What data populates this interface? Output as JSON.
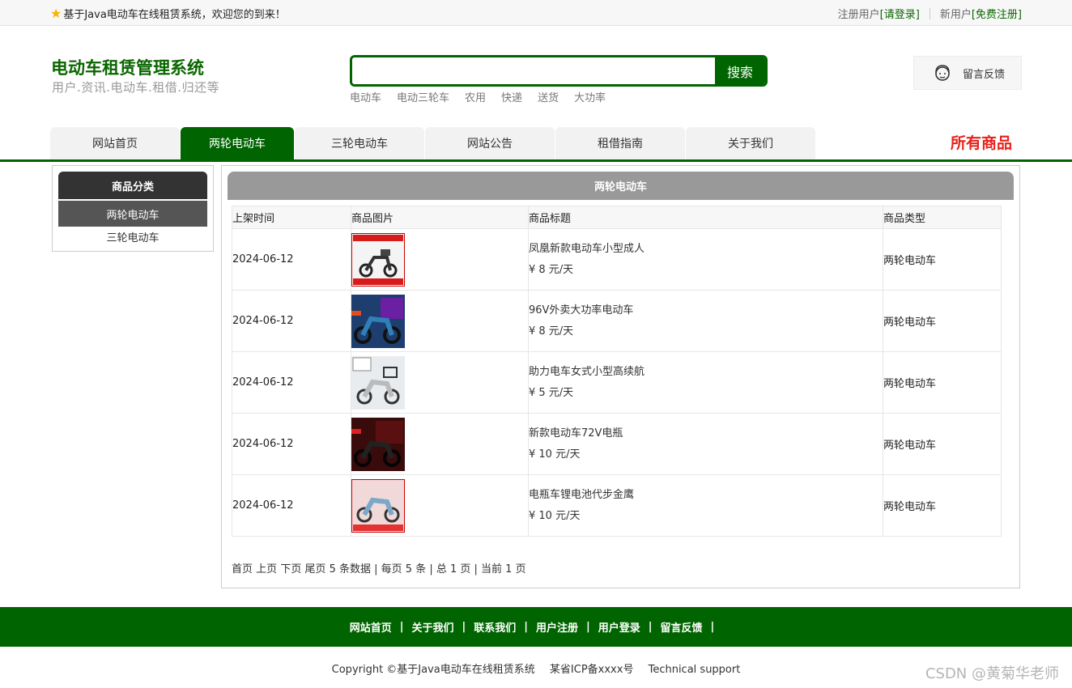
{
  "topbar": {
    "welcome": "基于Java电动车在线租赁系统，欢迎您的到来！",
    "register_user_label": "注册用户",
    "login_link": "[请登录]",
    "new_user_label": "新用户",
    "register_link": "[免费注册]"
  },
  "header": {
    "title": "电动车租赁管理系统",
    "subtitle": "用户.资讯.电动车.租借.归还等",
    "search": {
      "value": "",
      "button": "搜索"
    },
    "hotwords": [
      "电动车",
      "电动三轮车",
      "农用",
      "快递",
      "送货",
      "大功率"
    ],
    "feedback": "留言反馈"
  },
  "nav": {
    "tabs": [
      "网站首页",
      "两轮电动车",
      "三轮电动车",
      "网站公告",
      "租借指南",
      "关于我们"
    ],
    "active": "两轮电动车",
    "all_goods": "所有商品"
  },
  "sidebar": {
    "heading": "商品分类",
    "items": [
      "两轮电动车",
      "三轮电动车"
    ]
  },
  "main": {
    "heading": "两轮电动车",
    "columns": [
      "上架时间",
      "商品图片",
      "商品标题",
      "商品类型"
    ],
    "rows": [
      {
        "date": "2024-06-12",
        "title": "凤凰新款电动车小型成人",
        "price": "¥ 8 元/天",
        "type": "两轮电动车"
      },
      {
        "date": "2024-06-12",
        "title": "96V外卖大功率电动车",
        "price": "¥ 8 元/天",
        "type": "两轮电动车"
      },
      {
        "date": "2024-06-12",
        "title": "助力电车女式小型高续航",
        "price": "¥ 5 元/天",
        "type": "两轮电动车"
      },
      {
        "date": "2024-06-12",
        "title": "新款电动车72V电瓶",
        "price": "¥ 10 元/天",
        "type": "两轮电动车"
      },
      {
        "date": "2024-06-12",
        "title": "电瓶车锂电池代步金鹰",
        "price": "¥ 10 元/天",
        "type": "两轮电动车"
      }
    ],
    "pager": {
      "first": "首页",
      "prev": "上页",
      "next": "下页",
      "last": "尾页",
      "summary": "5 条数据 | 每页 5 条 | 总 1 页 | 当前 1 页"
    }
  },
  "footer": {
    "links": [
      "网站首页",
      "关于我们",
      "联系我们",
      "用户注册",
      "用户登录",
      "留言反馈"
    ],
    "pipe": "|",
    "copyright": "Copyright ©基于Java电动车在线租赁系统",
    "icp": "某省ICP备xxxx号",
    "support": "Technical support"
  },
  "watermark": "CSDN @黄菊华老师",
  "colors": {
    "brand_green": "#006400",
    "accent_red": "#e8211a"
  }
}
